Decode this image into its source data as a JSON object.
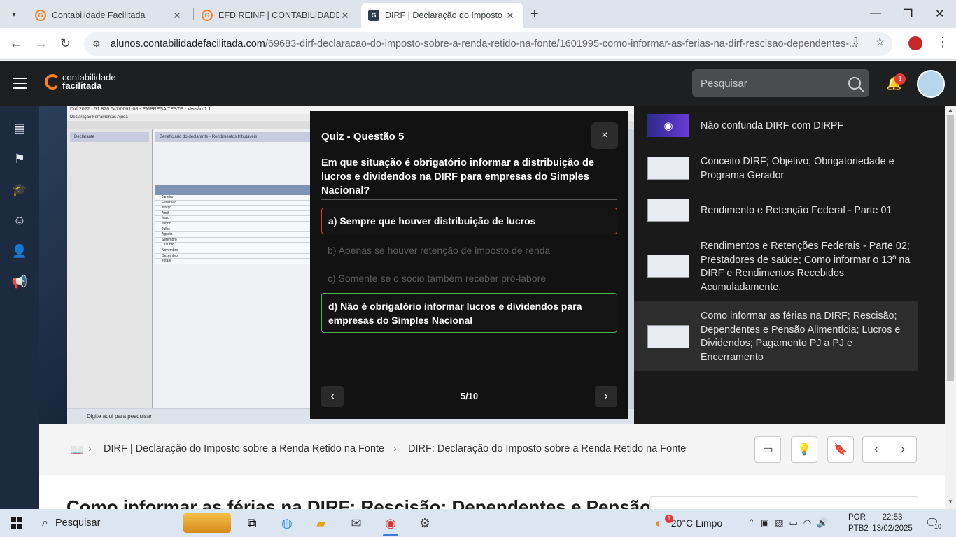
{
  "browser": {
    "tabs": [
      {
        "title": "Contabilidade Facilitada",
        "active": false
      },
      {
        "title": "EFD REINF | CONTABILIDADE FA",
        "active": false
      },
      {
        "title": "DIRF | Declaração do Imposto s",
        "active": true
      }
    ],
    "url_domain": "alunos.contabilidadefacilitada.com",
    "url_path": "/69683-dirf-declaracao-do-imposto-sobre-a-renda-retido-na-fonte/1601995-como-informar-as-ferias-na-dirf-rescisao-dependentes-..."
  },
  "site": {
    "logo_line1": "contabilidade",
    "logo_line2": "facilitada",
    "search_placeholder": "Pesquisar",
    "notification_count": "1"
  },
  "video": {
    "window_title": "Dirf 2022 - 51.826.647/0001-08 - EMPRESA TESTE - Versão 1.1",
    "menu": "Declaração   Ferramentas   Ajuda",
    "left_header": "Declarante",
    "main_header": "Beneficiário do declarante - Rendimentos tributáveis",
    "months": [
      "Janeiro",
      "Fevereiro",
      "Março",
      "Abril",
      "Maio",
      "Junho",
      "Julho",
      "Agosto",
      "Setembro",
      "Outubro",
      "Novembro",
      "Dezembro",
      "Totais"
    ],
    "taskbar_search": "Digite aqui para pesquisar"
  },
  "quiz": {
    "title": "Quiz - Questão 5",
    "close": "×",
    "question": "Em que situação é obrigatório informar a distribuição de lucros e dividendos na DIRF para empresas do Simples Nacional?",
    "options": [
      "a) Sempre que houver distribuição de lucros",
      "b) Apenas se houver retenção de imposto de renda",
      "c) Somente se o sócio também receber pró-labore",
      "d) Não é obrigatório informar lucros e dividendos para empresas do Simples Nacional"
    ],
    "selected_option": "a",
    "correct_option": "d",
    "progress": "5/10"
  },
  "playlist": [
    {
      "title": "Não confunda DIRF com DIRPF",
      "active": false
    },
    {
      "title": "Conceito DIRF; Objetivo; Obrigatoriedade e Programa Gerador",
      "active": false
    },
    {
      "title": "Rendimento e Retenção Federal - Parte 01",
      "active": false
    },
    {
      "title": "Rendimentos e Retenções Federais - Parte 02; Prestadores de saúde; Como informar o 13º na DIRF e Rendimentos Recebidos Acumuladamente.",
      "active": false
    },
    {
      "title": "Como informar as férias na DIRF; Rescisão; Dependentes e Pensão Alimentícia; Lucros e Dividendos; Pagamento PJ a PJ e Encerramento",
      "active": true
    }
  ],
  "breadcrumb": {
    "course": "DIRF | Declaração do Imposto sobre a Renda Retido na Fonte",
    "module": "DIRF: Declaração do Imposto sobre a Renda Retido na Fonte"
  },
  "lesson_title": "Como informar as férias na DIRF; Rescisão; Dependentes e Pensão",
  "taskbar": {
    "search": "Pesquisar",
    "weather_badge": "1",
    "weather": "20°C  Limpo",
    "lang_line1": "POR",
    "lang_line2": "PTB2",
    "time": "22:53",
    "date": "13/02/2025",
    "notif_count": "10"
  }
}
